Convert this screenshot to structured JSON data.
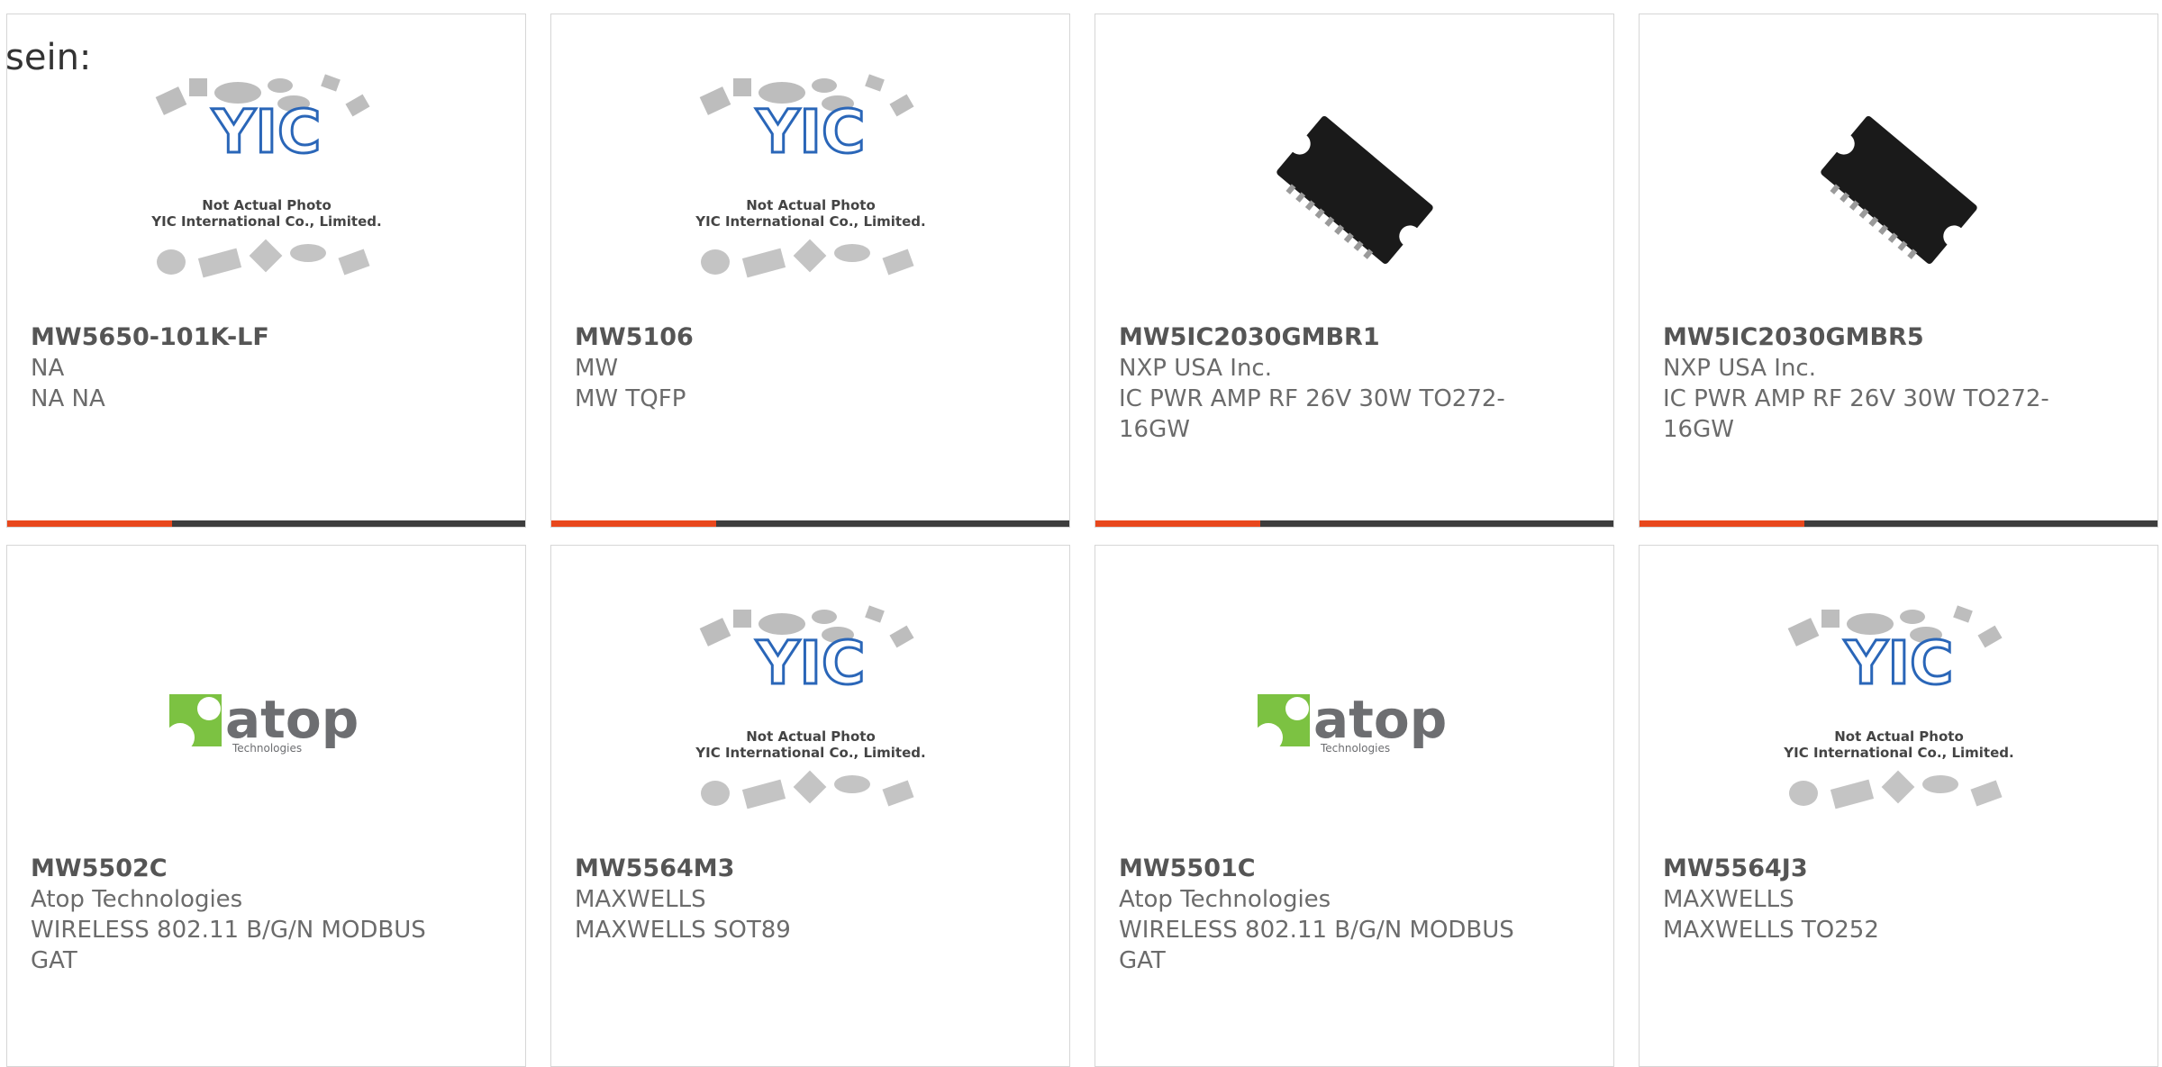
{
  "lead_text": "sein:",
  "colors": {
    "accent": "#e8471c",
    "bar": "#3d3d3d",
    "yic_blue": "#2a66b8",
    "atop_green": "#7cc242",
    "atop_gray": "#6d6e71"
  },
  "placeholder": {
    "line1": "Not Actual Photo",
    "line2": "YIC International Co., Limited.",
    "logo": "YIC"
  },
  "atop_logo": {
    "word": "atop",
    "sub": "Technologies"
  },
  "products": [
    {
      "part": "MW5650-101K-LF",
      "manufacturer": "NA",
      "description": "NA NA",
      "image": "placeholder-photo"
    },
    {
      "part": "MW5106",
      "manufacturer": "MW",
      "description": "MW TQFP",
      "image": "placeholder-photo"
    },
    {
      "part": "MW5IC2030GMBR1",
      "manufacturer": "NXP USA Inc.",
      "description": "IC PWR AMP RF 26V 30W TO272-16GW",
      "image": "chip-photo"
    },
    {
      "part": "MW5IC2030GMBR5",
      "manufacturer": "NXP USA Inc.",
      "description": "IC PWR AMP RF 26V 30W TO272-16GW",
      "image": "chip-photo"
    },
    {
      "part": "MW5502C",
      "manufacturer": "Atop Technologies",
      "description": "WIRELESS 802.11 B/G/N MODBUS GAT",
      "image": "atop-logo"
    },
    {
      "part": "MW5564M3",
      "manufacturer": "MAXWELLS",
      "description": "MAXWELLS SOT89",
      "image": "placeholder-photo"
    },
    {
      "part": "MW5501C",
      "manufacturer": "Atop Technologies",
      "description": "WIRELESS 802.11 B/G/N MODBUS GAT",
      "image": "atop-logo"
    },
    {
      "part": "MW5564J3",
      "manufacturer": "MAXWELLS",
      "description": "MAXWELLS TO252",
      "image": "placeholder-photo"
    }
  ]
}
